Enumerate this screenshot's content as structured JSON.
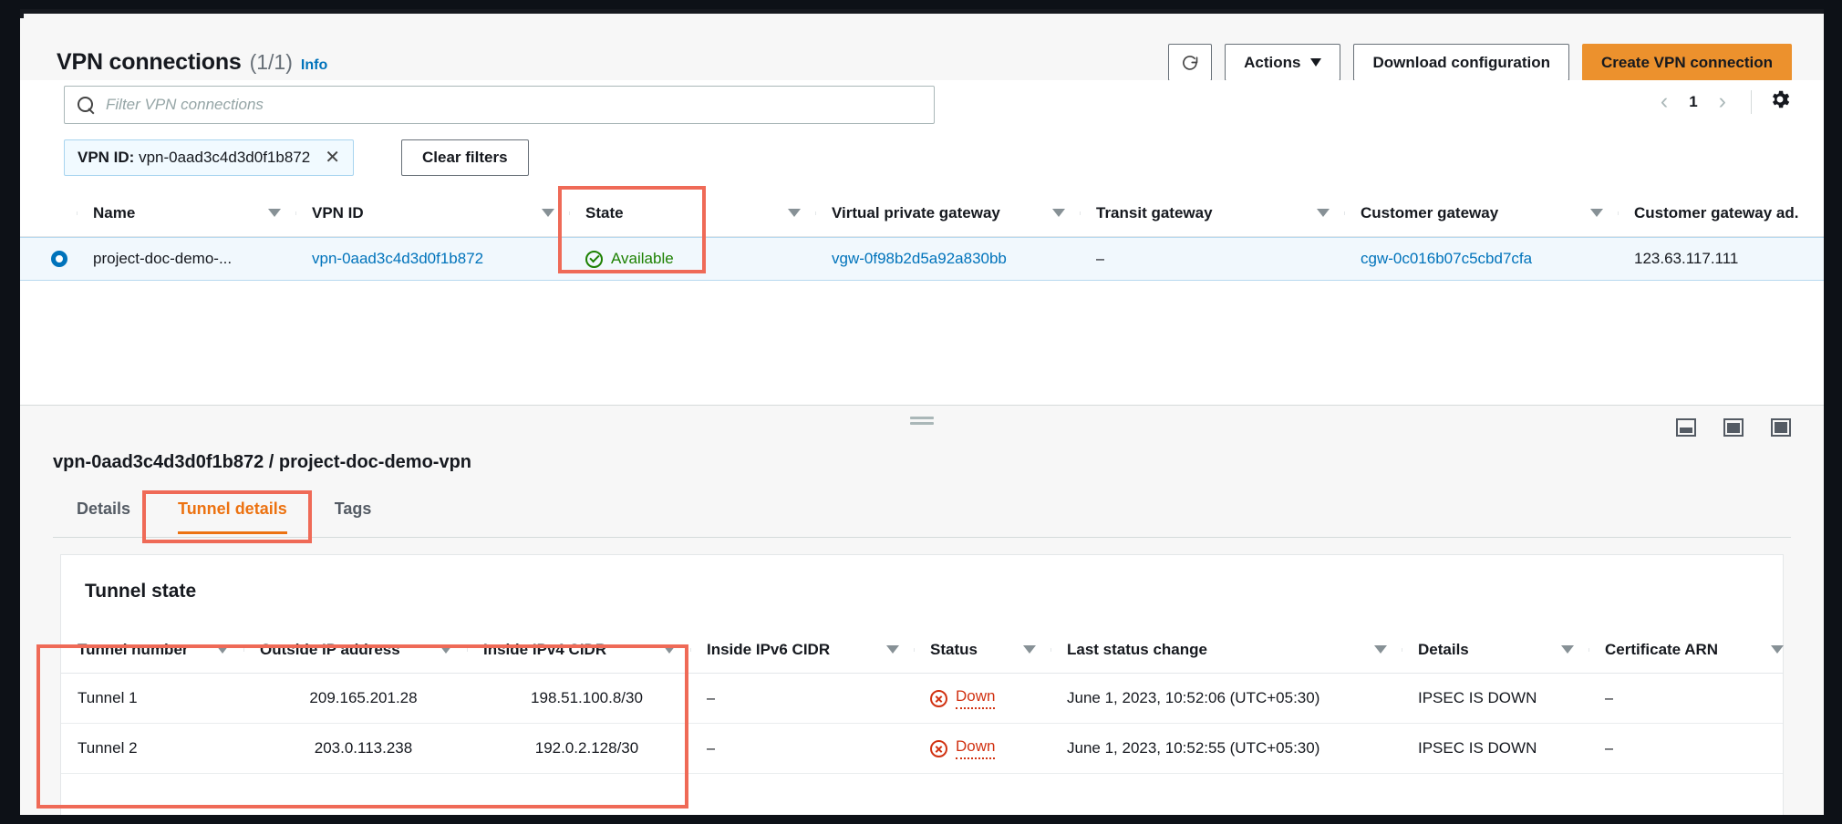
{
  "header": {
    "title": "VPN connections",
    "count": "(1/1)",
    "info_link": "Info",
    "refresh_icon": "refresh-icon",
    "actions_label": "Actions",
    "download_label": "Download configuration",
    "create_label": "Create VPN connection",
    "accent_color": "#ec912d"
  },
  "search": {
    "placeholder": "Filter VPN connections",
    "icon": "search-icon"
  },
  "pagination": {
    "prev": "‹",
    "page": "1",
    "next": "›",
    "settings_icon": "gear-icon"
  },
  "filters": {
    "token_label": "VPN ID:",
    "token_value": "vpn-0aad3c4d3d0f1b872",
    "token_remove_icon": "close-icon",
    "clear_label": "Clear filters"
  },
  "connections_table": {
    "columns": [
      "Name",
      "VPN ID",
      "State",
      "Virtual private gateway",
      "Transit gateway",
      "Customer gateway",
      "Customer gateway ad."
    ],
    "rows": [
      {
        "selected": true,
        "name": "project-doc-demo-...",
        "vpn_id": "vpn-0aad3c4d3d0f1b872",
        "state": "Available",
        "state_icon": "check-circle-icon",
        "state_color": "#1d8102",
        "virtual_private_gateway": "vgw-0f98b2d5a92a830bb",
        "transit_gateway": "–",
        "customer_gateway": "cgw-0c016b07c5cbd7cfa",
        "customer_gateway_address": "123.63.117.111"
      }
    ]
  },
  "split_panel": {
    "drag_handle": "drag-handle",
    "size_icons": [
      "panel-small-icon",
      "panel-medium-icon",
      "panel-large-icon"
    ]
  },
  "detail": {
    "title": "vpn-0aad3c4d3d0f1b872 / project-doc-demo-vpn",
    "tabs": [
      {
        "label": "Details",
        "active": false
      },
      {
        "label": "Tunnel details",
        "active": true
      },
      {
        "label": "Tags",
        "active": false
      }
    ],
    "section_title": "Tunnel state",
    "tunnel_table": {
      "columns": [
        "Tunnel number",
        "Outside IP address",
        "Inside IPv4 CIDR",
        "Inside IPv6 CIDR",
        "Status",
        "Last status change",
        "Details",
        "Certificate ARN"
      ],
      "rows": [
        {
          "tunnel_number": "Tunnel 1",
          "outside_ip": "209.165.201.28",
          "inside_ipv4": "198.51.100.8/30",
          "inside_ipv6": "–",
          "status": "Down",
          "status_icon": "error-circle-icon",
          "status_color": "#d13212",
          "last_status_change": "June 1, 2023, 10:52:06 (UTC+05:30)",
          "details": "IPSEC IS DOWN",
          "certificate_arn": "–"
        },
        {
          "tunnel_number": "Tunnel 2",
          "outside_ip": "203.0.113.238",
          "inside_ipv4": "192.0.2.128/30",
          "inside_ipv6": "–",
          "status": "Down",
          "status_icon": "error-circle-icon",
          "status_color": "#d13212",
          "last_status_change": "June 1, 2023, 10:52:55 (UTC+05:30)",
          "details": "IPSEC IS DOWN",
          "certificate_arn": "–"
        }
      ]
    }
  },
  "annotations": {
    "color": "#ef6a57",
    "boxes": [
      "state-column-highlight",
      "tunnel-details-tab-highlight",
      "tunnel-columns-highlight"
    ]
  }
}
